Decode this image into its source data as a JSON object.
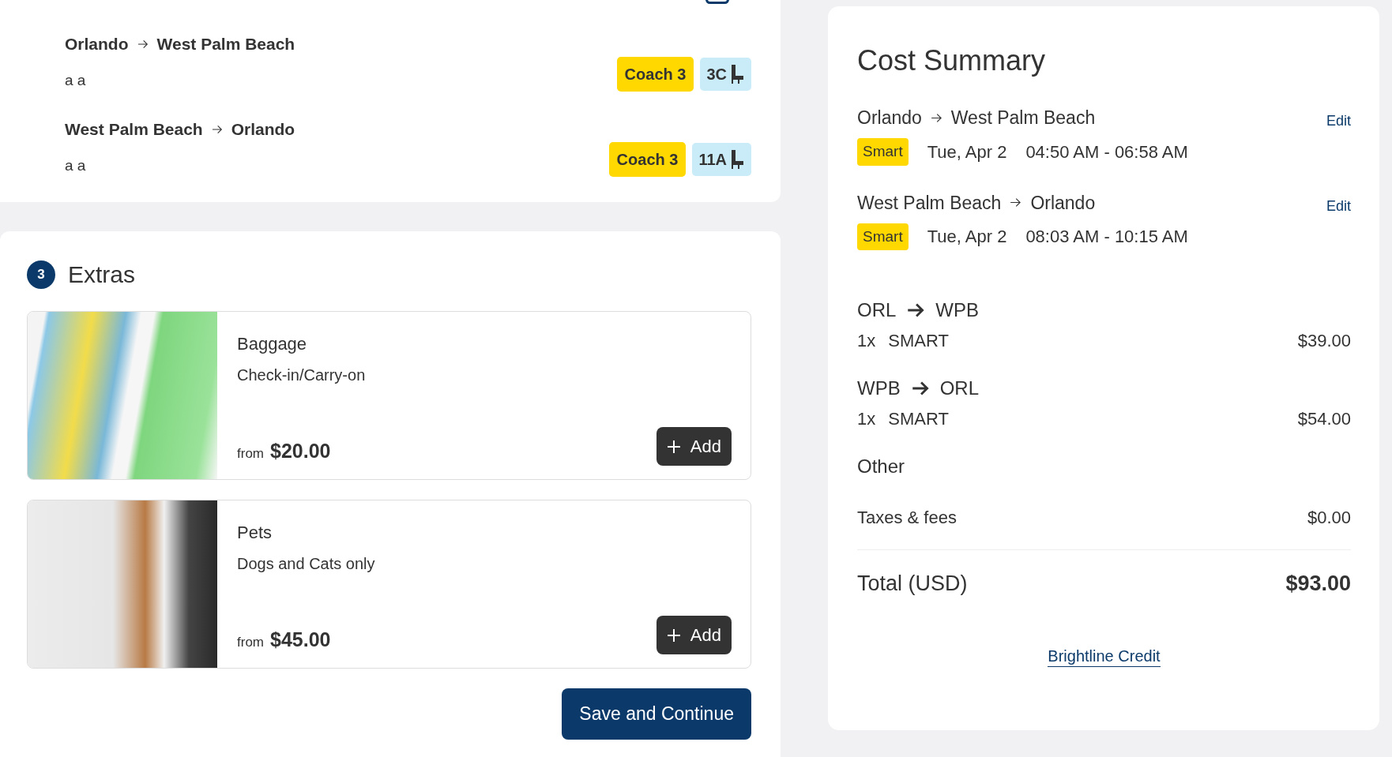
{
  "trips": [
    {
      "from": "Orlando",
      "to": "West Palm Beach",
      "passenger": "a a",
      "coach": "Coach 3",
      "seat": "3C"
    },
    {
      "from": "West Palm Beach",
      "to": "Orlando",
      "passenger": "a a",
      "coach": "Coach 3",
      "seat": "11A"
    }
  ],
  "extras": {
    "step": "3",
    "title": "Extras",
    "items": [
      {
        "kind": "baggage",
        "title": "Baggage",
        "subtitle": "Check-in/Carry-on",
        "from_label": "from",
        "price": "$20.00",
        "button": "Add"
      },
      {
        "kind": "pets",
        "title": "Pets",
        "subtitle": "Dogs and Cats only",
        "from_label": "from",
        "price": "$45.00",
        "button": "Add"
      }
    ],
    "save_button": "Save and Continue"
  },
  "cost_summary": {
    "title": "Cost Summary",
    "trips": [
      {
        "from": "Orlando",
        "to": "West Palm Beach",
        "edit": "Edit",
        "fare": "Smart",
        "date": "Tue, Apr 2",
        "time": "04:50 AM - 06:58 AM"
      },
      {
        "from": "West Palm Beach",
        "to": "Orlando",
        "edit": "Edit",
        "fare": "Smart",
        "date": "Tue, Apr 2",
        "time": "08:03 AM - 10:15 AM"
      }
    ],
    "fares": [
      {
        "from": "ORL",
        "to": "WPB",
        "quantity": "1x",
        "fare": "SMART",
        "price": "$39.00"
      },
      {
        "from": "WPB",
        "to": "ORL",
        "quantity": "1x",
        "fare": "SMART",
        "price": "$54.00"
      }
    ],
    "other": {
      "title": "Other",
      "items": [
        {
          "label": "Taxes & fees",
          "price": "$0.00"
        }
      ]
    },
    "total": {
      "label": "Total (USD)",
      "amount": "$93.00"
    },
    "credit_link": "Brightline Credit"
  }
}
